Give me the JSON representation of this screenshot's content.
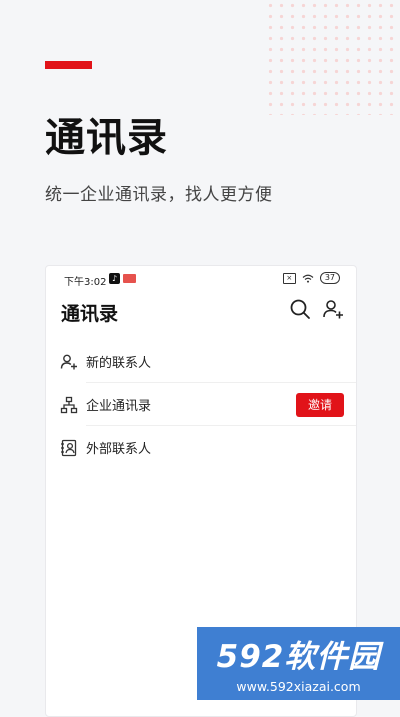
{
  "hero": {
    "title": "通讯录",
    "subtitle": "统一企业通讯录，找人更方便"
  },
  "status_bar": {
    "time": "下午3:02",
    "battery": "37"
  },
  "app": {
    "title": "通讯录",
    "rows": [
      {
        "label": "新的联系人",
        "icon": "add-contact-icon"
      },
      {
        "label": "企业通讯录",
        "icon": "org-chart-icon",
        "action": "邀请"
      },
      {
        "label": "外部联系人",
        "icon": "external-contact-icon"
      }
    ]
  },
  "watermark": {
    "brand": "592软件园",
    "url": "www.592xiazai.com"
  },
  "colors": {
    "accent": "#e11319",
    "background": "#f5f6f8",
    "watermark": "#3f7fd2"
  }
}
